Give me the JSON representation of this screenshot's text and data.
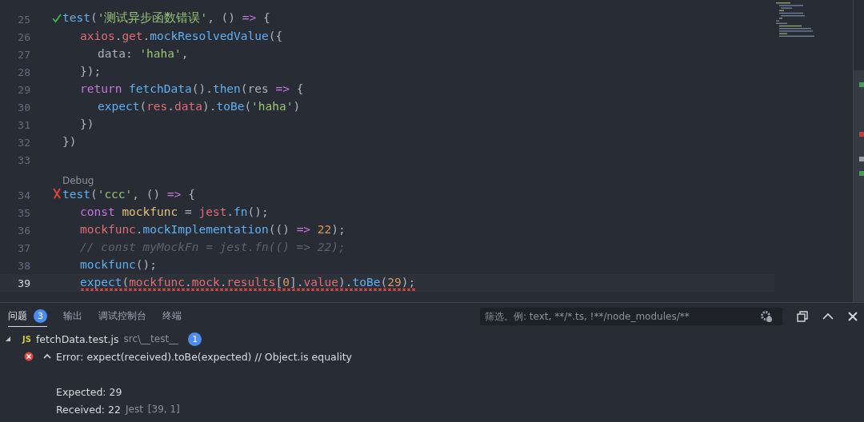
{
  "editor": {
    "lines": [
      {
        "number": "25",
        "test": {
          "passed": true
        },
        "current": false,
        "error": false,
        "tokens": [
          {
            "kind": "fn",
            "text": "test"
          },
          {
            "kind": "plain",
            "text": "("
          },
          {
            "kind": "str",
            "text": "'测试异步函数错误'"
          },
          {
            "kind": "plain",
            "text": ", () "
          },
          {
            "kind": "kw",
            "text": "=>"
          },
          {
            "kind": "plain",
            "text": " {"
          }
        ],
        "children": [
          {
            "number": "26",
            "current": false,
            "error": false,
            "tokens": [
              {
                "kind": "var",
                "text": "axios"
              },
              {
                "kind": "plain",
                "text": "."
              },
              {
                "kind": "var",
                "text": "get"
              },
              {
                "kind": "plain",
                "text": "."
              },
              {
                "kind": "fn",
                "text": "mockResolvedValue"
              },
              {
                "kind": "plain",
                "text": "({"
              }
            ],
            "children": [
              {
                "number": "27",
                "current": false,
                "error": false,
                "tokens": [
                  {
                    "kind": "plain",
                    "text": "data: "
                  },
                  {
                    "kind": "str",
                    "text": "'haha'"
                  },
                  {
                    "kind": "plain",
                    "text": ","
                  }
                ]
              }
            ]
          },
          {
            "number": "28",
            "current": false,
            "error": false,
            "tokens": [
              {
                "kind": "plain",
                "text": "});"
              }
            ]
          },
          {
            "number": "29",
            "current": false,
            "error": false,
            "tokens": [
              {
                "kind": "kw",
                "text": "return"
              },
              {
                "kind": "fn",
                "text": " fetchData"
              },
              {
                "kind": "plain",
                "text": "()."
              },
              {
                "kind": "fn",
                "text": "then"
              },
              {
                "kind": "plain",
                "text": "(res "
              },
              {
                "kind": "kw",
                "text": "=>"
              },
              {
                "kind": "plain",
                "text": " {"
              }
            ],
            "children": [
              {
                "number": "30",
                "current": false,
                "error": false,
                "tokens": [
                  {
                    "kind": "fn",
                    "text": "expect"
                  },
                  {
                    "kind": "plain",
                    "text": "("
                  },
                  {
                    "kind": "var",
                    "text": "res"
                  },
                  {
                    "kind": "plain",
                    "text": "."
                  },
                  {
                    "kind": "var",
                    "text": "data"
                  },
                  {
                    "kind": "plain",
                    "text": ")."
                  },
                  {
                    "kind": "fn",
                    "text": "toBe"
                  },
                  {
                    "kind": "plain",
                    "text": "("
                  },
                  {
                    "kind": "str",
                    "text": "'haha'"
                  },
                  {
                    "kind": "plain",
                    "text": ")"
                  }
                ]
              }
            ]
          },
          {
            "number": "31",
            "current": false,
            "error": false,
            "tokens": [
              {
                "kind": "plain",
                "text": "})"
              }
            ]
          }
        ]
      },
      {
        "number": "32",
        "current": false,
        "error": false,
        "tokens": [
          {
            "kind": "plain",
            "text": "})"
          }
        ]
      },
      {
        "number": "33"
      },
      {
        "number": "34",
        "test": {
          "passed": false
        },
        "codelens": "Debug",
        "current": false,
        "error": false,
        "tokens": [
          {
            "kind": "fn",
            "text": "test"
          },
          {
            "kind": "plain",
            "text": "("
          },
          {
            "kind": "str",
            "text": "'ccc'"
          },
          {
            "kind": "plain",
            "text": ", () "
          },
          {
            "kind": "kw",
            "text": "=>"
          },
          {
            "kind": "plain",
            "text": " {"
          }
        ],
        "children": [
          {
            "number": "35",
            "current": false,
            "error": false,
            "tokens": [
              {
                "kind": "kw",
                "text": "const"
              },
              {
                "kind": "const",
                "text": " mockfunc"
              },
              {
                "kind": "plain",
                "text": " = "
              },
              {
                "kind": "var",
                "text": "jest"
              },
              {
                "kind": "plain",
                "text": "."
              },
              {
                "kind": "fn",
                "text": "fn"
              },
              {
                "kind": "plain",
                "text": "();"
              }
            ]
          },
          {
            "number": "36",
            "current": false,
            "error": false,
            "tokens": [
              {
                "kind": "var",
                "text": "mockfunc"
              },
              {
                "kind": "plain",
                "text": "."
              },
              {
                "kind": "fn",
                "text": "mockImplementation"
              },
              {
                "kind": "plain",
                "text": "(() "
              },
              {
                "kind": "kw",
                "text": "=>"
              },
              {
                "kind": "num",
                "text": " 22"
              },
              {
                "kind": "plain",
                "text": ");"
              }
            ]
          },
          {
            "number": "37",
            "current": false,
            "error": false,
            "tokens": [
              {
                "kind": "comment",
                "text": "// const myMockFn = jest.fn(() => 22);"
              }
            ]
          },
          {
            "number": "38",
            "current": false,
            "error": false,
            "tokens": [
              {
                "kind": "fn",
                "text": "mockfunc"
              },
              {
                "kind": "plain",
                "text": "();"
              }
            ]
          },
          {
            "number": "39",
            "current": true,
            "error": true,
            "tokens": [
              {
                "kind": "fn",
                "text": "expect"
              },
              {
                "kind": "plain",
                "text": "("
              },
              {
                "kind": "var",
                "text": "mockfunc"
              },
              {
                "kind": "plain",
                "text": "."
              },
              {
                "kind": "var",
                "text": "mock"
              },
              {
                "kind": "plain",
                "text": "."
              },
              {
                "kind": "var",
                "text": "results"
              },
              {
                "kind": "plain",
                "text": "["
              },
              {
                "kind": "num",
                "text": "0"
              },
              {
                "kind": "plain",
                "text": "]."
              },
              {
                "kind": "var",
                "text": "value"
              },
              {
                "kind": "plain",
                "text": ")."
              },
              {
                "kind": "fn",
                "text": "toBe"
              },
              {
                "kind": "plain",
                "text": "("
              },
              {
                "kind": "num",
                "text": "29"
              },
              {
                "kind": "plain",
                "text": ");"
              }
            ]
          }
        ]
      }
    ]
  },
  "panel": {
    "tabs": [
      {
        "label": "问题",
        "badge": "3",
        "selected": true
      },
      {
        "label": "输出",
        "selected": false
      },
      {
        "label": "调试控制台",
        "selected": false
      },
      {
        "label": "终端",
        "selected": false
      }
    ],
    "filter": {
      "placeholder": "筛选。例: text, **/*.ts, !**/node_modules/**"
    },
    "problems": [
      {
        "file_icon": "JS",
        "file": "fetchData.test.js",
        "path": "src\\__test__",
        "count": "1",
        "expanded": true,
        "items": [
          {
            "message": "Error: expect(received).toBe(expected) // Object.is equality",
            "expanded": true,
            "details": [
              "Expected: 29",
              "Received: 22"
            ],
            "source": "Jest",
            "position": "[39, 1]"
          }
        ]
      }
    ]
  }
}
